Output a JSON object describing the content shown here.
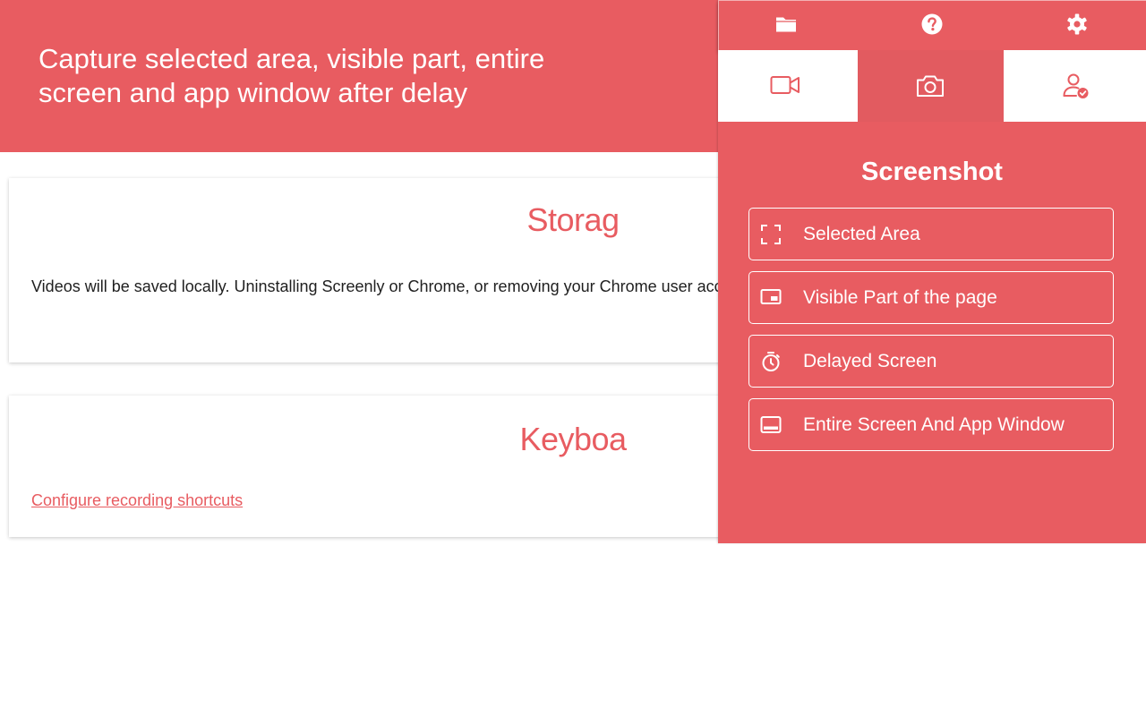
{
  "banner": {
    "title": "Capture selected area, visible part, entire screen and app window after delay"
  },
  "storage_card": {
    "heading": "Storag",
    "text": "Videos will be saved locally. Uninstalling Screenly or Chrome, or removing your Chrome user accou soon as you created them."
  },
  "keyboard_card": {
    "heading": "Keyboa",
    "link": "Configure recording shortcuts"
  },
  "popup": {
    "topbar": {
      "folder_icon": "folder-icon",
      "help_icon": "question-circle-icon",
      "settings_icon": "gear-icon"
    },
    "tabs": [
      {
        "icon": "video-camera-icon",
        "active": false
      },
      {
        "icon": "camera-icon",
        "active": true
      },
      {
        "icon": "user-check-icon",
        "active": false
      }
    ],
    "title": "Screenshot",
    "options": [
      {
        "label": "Selected Area",
        "icon": "selection-corners-icon"
      },
      {
        "label": "Visible Part of the page",
        "icon": "picture-in-picture-icon"
      },
      {
        "label": "Delayed Screen",
        "icon": "stopwatch-icon"
      },
      {
        "label": "Entire Screen And App Window",
        "icon": "window-icon"
      }
    ]
  },
  "colors": {
    "accent": "#e85c61",
    "active_tab": "#e25b60",
    "white": "#ffffff",
    "text": "#1f1f1f"
  }
}
